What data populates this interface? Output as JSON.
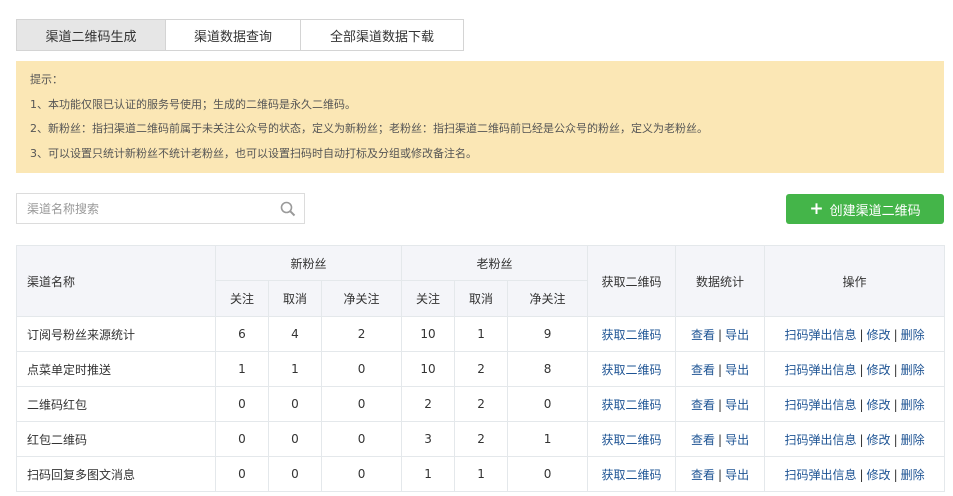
{
  "tabs": [
    {
      "label": "渠道二维码生成"
    },
    {
      "label": "渠道数据查询"
    },
    {
      "label": "全部渠道数据下载"
    }
  ],
  "tips": {
    "title": "提示：",
    "lines": [
      "1、本功能仅限已认证的服务号使用；生成的二维码是永久二维码。",
      "2、新粉丝：指扫渠道二维码前属于未关注公众号的状态，定义为新粉丝；老粉丝：指扫渠道二维码前已经是公众号的粉丝，定义为老粉丝。",
      "3、可以设置只统计新粉丝不统计老粉丝，也可以设置扫码时自动打标及分组或修改备注名。"
    ]
  },
  "search": {
    "placeholder": "渠道名称搜索",
    "value": "",
    "icon": "search-icon"
  },
  "create_button": {
    "label": "创建渠道二维码",
    "icon": "plus-icon",
    "color": "#44b549"
  },
  "table": {
    "headers": {
      "name": "渠道名称",
      "new_fans": "新粉丝",
      "old_fans": "老粉丝",
      "get_qr": "获取二维码",
      "stats": "数据统计",
      "ops": "操作",
      "follow": "关注",
      "cancel": "取消",
      "net": "净关注"
    },
    "rows": [
      {
        "name": "订阅号粉丝来源统计",
        "new": [
          "6",
          "4",
          "2"
        ],
        "old": [
          "10",
          "1",
          "9"
        ],
        "get_qr": "获取二维码",
        "view": "查看",
        "export": "导出",
        "popup": "扫码弹出信息",
        "edit": "修改",
        "delete": "删除"
      },
      {
        "name": "点菜单定时推送",
        "new": [
          "1",
          "1",
          "0"
        ],
        "old": [
          "10",
          "2",
          "8"
        ],
        "get_qr": "获取二维码",
        "view": "查看",
        "export": "导出",
        "popup": "扫码弹出信息",
        "edit": "修改",
        "delete": "删除"
      },
      {
        "name": "二维码红包",
        "new": [
          "0",
          "0",
          "0"
        ],
        "old": [
          "2",
          "2",
          "0"
        ],
        "get_qr": "获取二维码",
        "view": "查看",
        "export": "导出",
        "popup": "扫码弹出信息",
        "edit": "修改",
        "delete": "删除"
      },
      {
        "name": "红包二维码",
        "new": [
          "0",
          "0",
          "0"
        ],
        "old": [
          "3",
          "2",
          "1"
        ],
        "get_qr": "获取二维码",
        "view": "查看",
        "export": "导出",
        "popup": "扫码弹出信息",
        "edit": "修改",
        "delete": "删除"
      },
      {
        "name": "扫码回复多图文消息",
        "new": [
          "0",
          "0",
          "0"
        ],
        "old": [
          "1",
          "1",
          "0"
        ],
        "get_qr": "获取二维码",
        "view": "查看",
        "export": "导出",
        "popup": "扫码弹出信息",
        "edit": "修改",
        "delete": "删除"
      }
    ],
    "link_color": "#1e5494"
  }
}
